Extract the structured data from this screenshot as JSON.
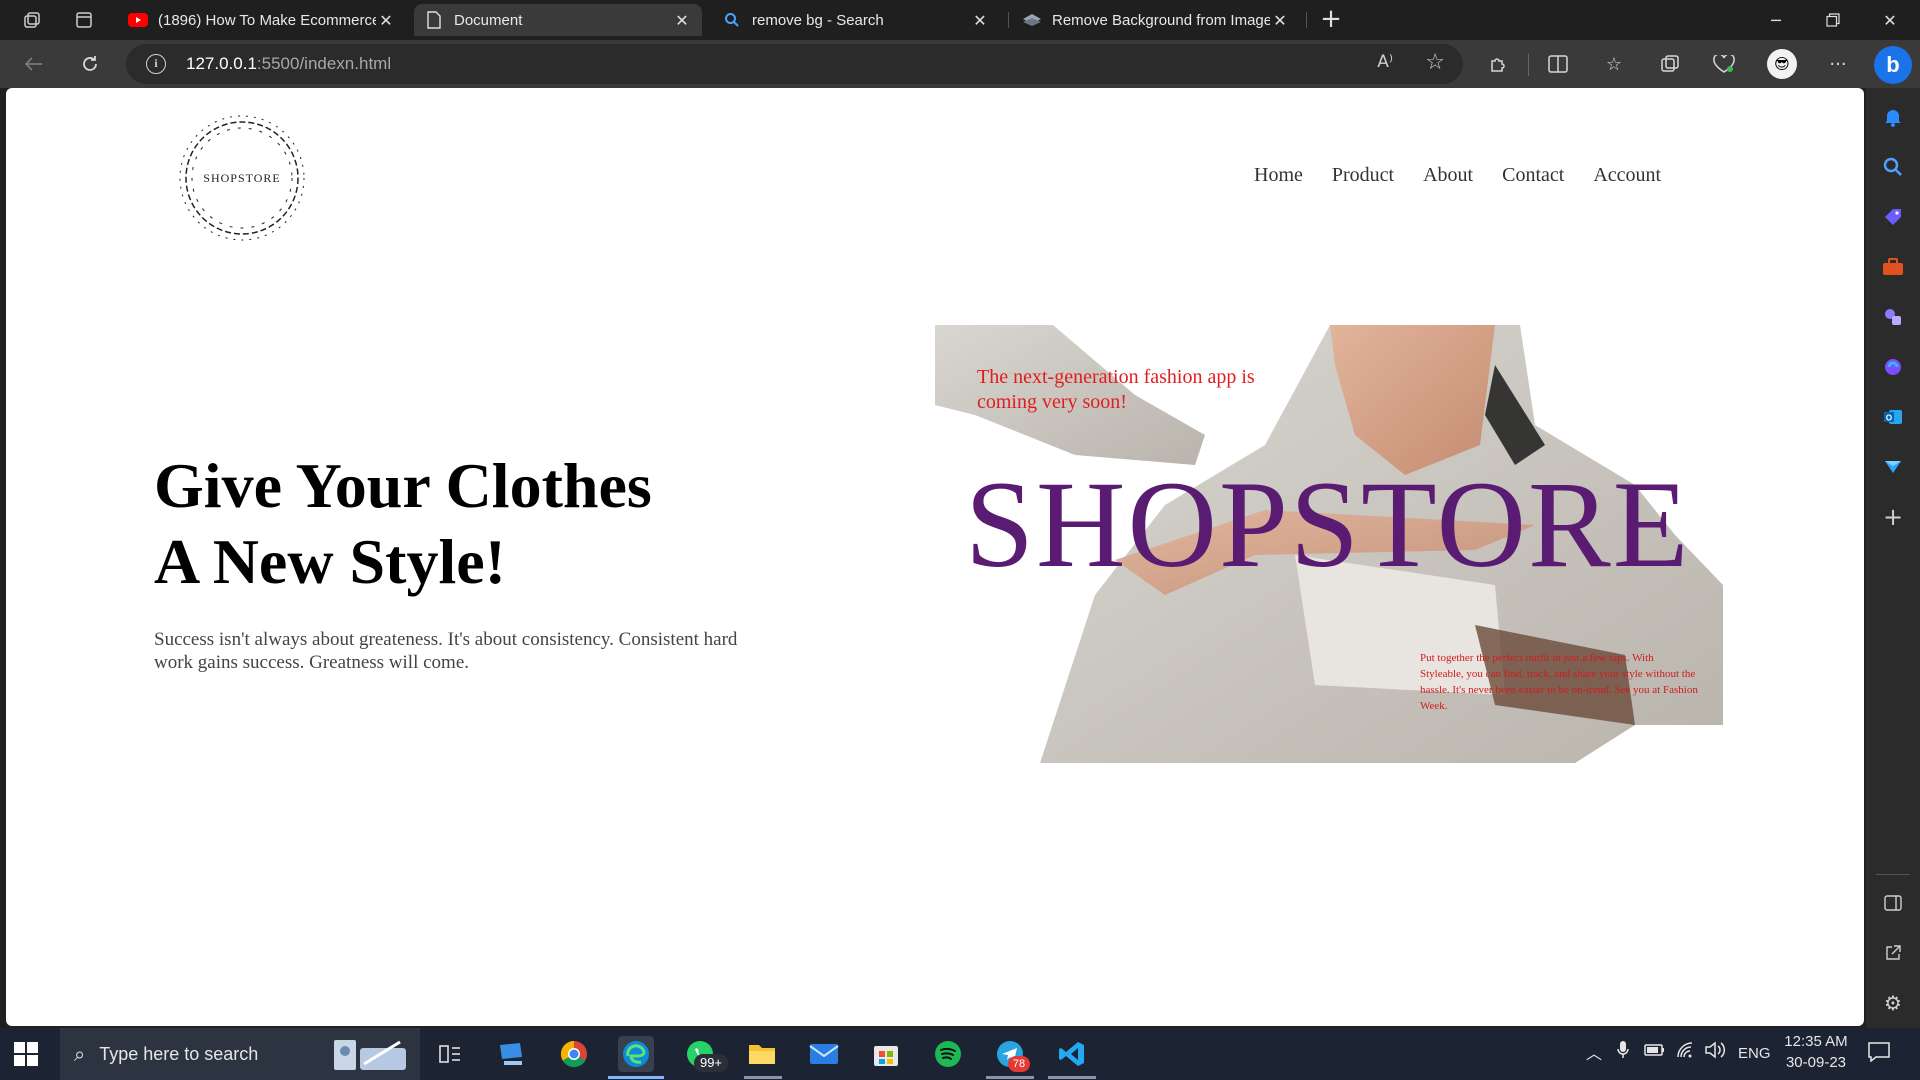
{
  "browser": {
    "tabs": [
      {
        "title": "(1896) How To Make Ecommerce",
        "icon": "youtube-icon",
        "active": false
      },
      {
        "title": "Document",
        "icon": "document-icon",
        "active": true
      },
      {
        "title": "remove bg - Search",
        "icon": "search-icon",
        "active": false
      },
      {
        "title": "Remove Background from Image",
        "icon": "layers-icon",
        "active": false
      }
    ],
    "url_host": "127.0.0.1",
    "url_rest": ":5500/indexn.html",
    "read_aloud": "A⁾"
  },
  "page": {
    "logo_text": "SHOPSTORE",
    "nav": [
      "Home",
      "Product",
      "About",
      "Contact",
      "Account"
    ],
    "hero": {
      "title_line1": "Give Your Clothes",
      "title_line2": "A New Style!",
      "subtitle": "Success isn't always about greateness. It's about consistency. Consistent hard work gains success. Greatness will come."
    },
    "hero_image": {
      "headline": "The next-generation fashion app is coming very soon!",
      "brand": "SHOPSTORE",
      "small_text": "Put together the perfect outfit in just a few taps. With Styleable, you can find, track, and share your style without the hassle. It's never been easier to be on-trend. See you at Fashion Week."
    }
  },
  "taskbar": {
    "search_placeholder": "Type here to search",
    "whatsapp_badge": "99+",
    "telegram_badge": "78",
    "language": "ENG",
    "time": "12:35 AM",
    "date": "30-09-23"
  },
  "colors": {
    "brand_purple": "#5a1c72",
    "accent_red": "#e21d1d",
    "taskbar": "#1c2433",
    "chrome_dark": "#1f1f1f"
  }
}
